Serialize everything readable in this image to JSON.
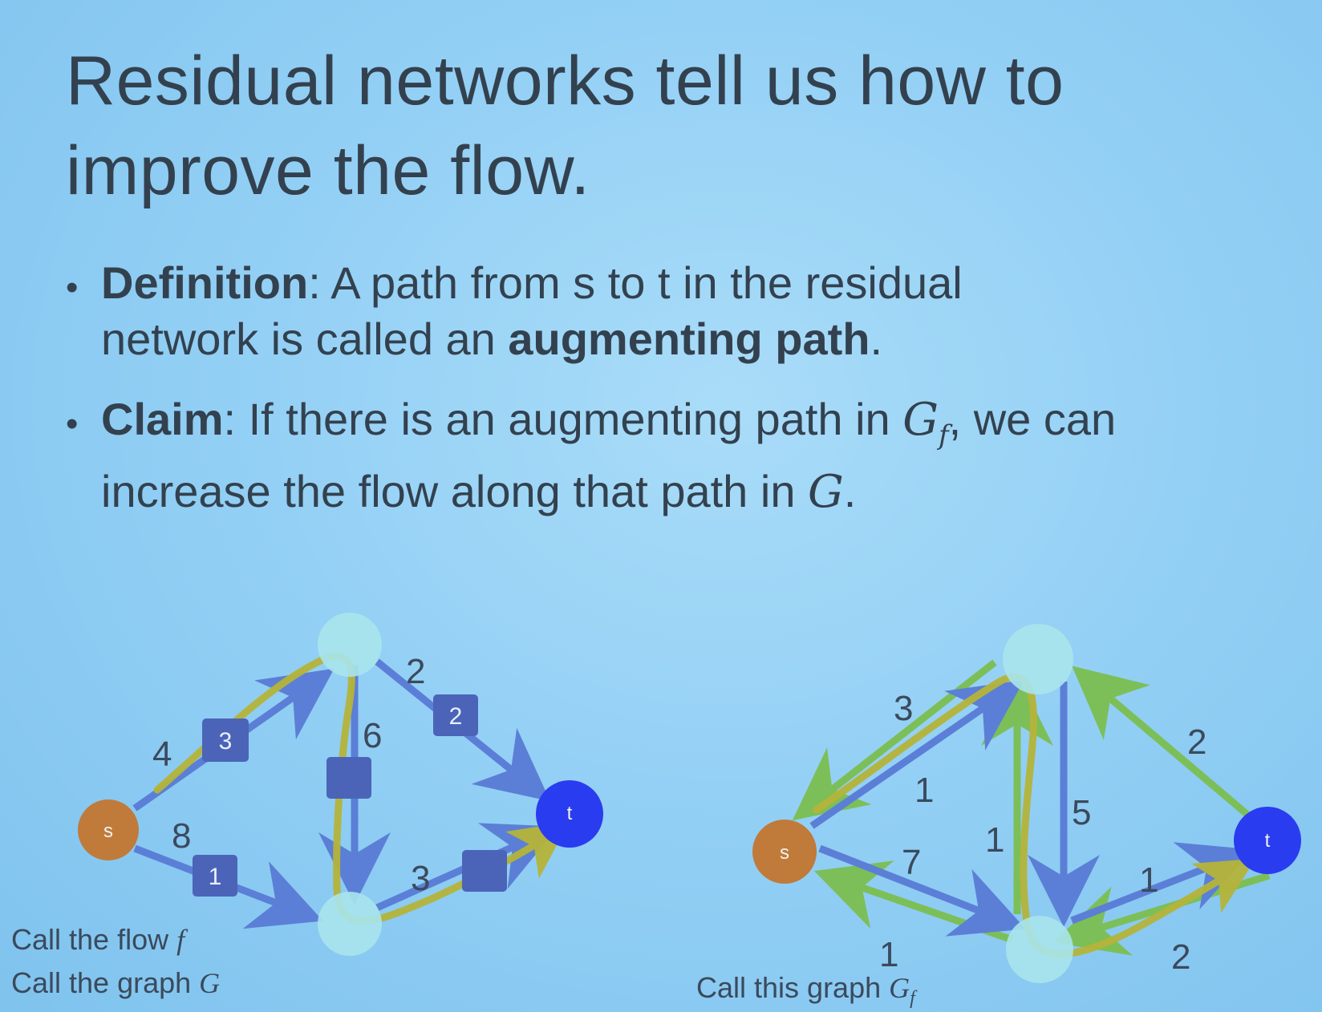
{
  "slide": {
    "title_line1": "Residual networks tell us how to",
    "title_line2": "improve the flow.",
    "bullets": [
      {
        "bold": "Definition",
        "text1": ": A path from s to t in the residual",
        "text2_pre": "network is called an ",
        "bold2": "augmenting path",
        "text2_post": "."
      },
      {
        "bold": "Claim",
        "text1": ": If there is an augmenting path in ",
        "math1": "G",
        "math1_sub": "f",
        "text1_post": ", we can",
        "text2_pre": "increase the flow along that path in ",
        "math2": "G",
        "text2_post": "."
      }
    ]
  },
  "left_graph": {
    "node_s": "s",
    "node_t": "t",
    "cap_s_a": "4",
    "flow_s_a": "3",
    "cap_s_b": "8",
    "flow_s_b": "1",
    "cap_a_b": "6",
    "cap_a_t": "2",
    "flow_a_t": "2",
    "cap_b_t": "3",
    "caption1_text": "Call the flow ",
    "caption1_math": "f",
    "caption2_text": "Call the graph ",
    "caption2_math": "G"
  },
  "right_graph": {
    "node_s": "s",
    "node_t": "t",
    "label_a_s": "3",
    "label_s_a": "1",
    "label_s_b": "7",
    "label_b_s": "1",
    "label_b_a": "1",
    "label_a_b": "5",
    "label_t_a": "2",
    "label_b_t": "1",
    "label_t_b": "2",
    "caption_text": "Call this graph ",
    "caption_math": "G",
    "caption_math_sub": "f"
  },
  "colors": {
    "background": "#94d0f5",
    "text": "#33414f",
    "edge_blue": "#5b7fd6",
    "edge_green": "#7cbf58",
    "path_yellow": "#b5b43a",
    "node_s": "#c07a3a",
    "node_t": "#2a3cf0",
    "node_mid": "#a8e4ec",
    "flow_box": "#4b64b8"
  }
}
